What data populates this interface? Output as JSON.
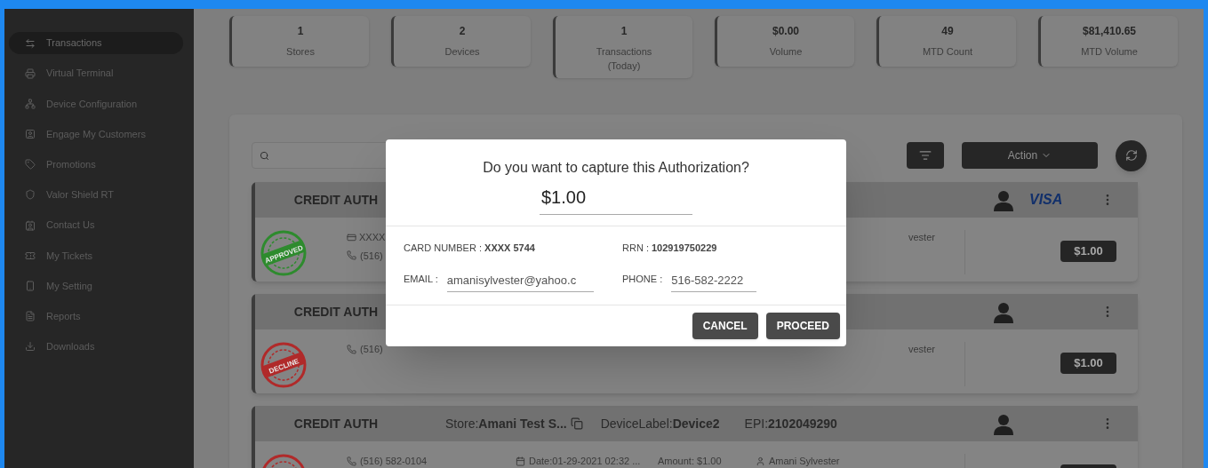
{
  "sidebar": {
    "items": [
      {
        "label": "Transactions",
        "selected": true
      },
      {
        "label": "Virtual Terminal",
        "selected": false
      },
      {
        "label": "Device Configuration",
        "selected": false
      },
      {
        "label": "Engage My Customers",
        "selected": false
      },
      {
        "label": "Promotions",
        "selected": false
      },
      {
        "label": "Valor Shield RT",
        "selected": false
      },
      {
        "label": "Contact Us",
        "selected": false
      },
      {
        "label": "My Tickets",
        "selected": false
      },
      {
        "label": "My Setting",
        "selected": false
      },
      {
        "label": "Reports",
        "selected": false
      },
      {
        "label": "Downloads",
        "selected": false
      }
    ]
  },
  "stats": [
    {
      "value": "1",
      "label": "Stores"
    },
    {
      "value": "2",
      "label": "Devices"
    },
    {
      "value": "1",
      "label": "Transactions (Today)"
    },
    {
      "value": "$0.00",
      "label": "Volume"
    },
    {
      "value": "49",
      "label": "MTD Count"
    },
    {
      "value": "$81,410.65",
      "label": "MTD Volume"
    }
  ],
  "toolbar": {
    "action": "Action"
  },
  "cards": [
    {
      "type": "CREDIT AUTH",
      "stamp": {
        "kind": "approved",
        "label": "APPROVED"
      },
      "card_number": "XXXX",
      "phone": "(516)",
      "customer": "vester",
      "brand": "VISA",
      "amount": "$1.00"
    },
    {
      "type": "CREDIT AUTH",
      "stamp": {
        "kind": "decline",
        "label": "DECLINE"
      },
      "phone": "(516)",
      "customer": "vester",
      "amount": "$1.00"
    },
    {
      "type": "CREDIT AUTH",
      "stamp": {
        "kind": "decline"
      },
      "store": "Store:**Amani Test S...**",
      "device": "DeviceLabel:**Device2**",
      "epi": "EPI:**2102049290**",
      "phone": "(516) 582-0104",
      "date": "Date:01-29-2021 02:32 ...",
      "amount_text": "Amount: $1.00",
      "customer": "Amani Sylvester"
    }
  ],
  "dialog": {
    "title": "Do you want to capture this Authorization?",
    "amount": "$1.00",
    "card_label": "CARD NUMBER :",
    "card_value": "XXXX 5744",
    "rrn_label": "RRN :",
    "rrn_value": "102919750229",
    "email_label": "EMAIL :",
    "email": "amanisylvester@yahoo.c",
    "phone_label": "PHONE :",
    "phone": "516-582-2222",
    "buttons": [
      "CANCEL",
      "PROCEED"
    ]
  }
}
